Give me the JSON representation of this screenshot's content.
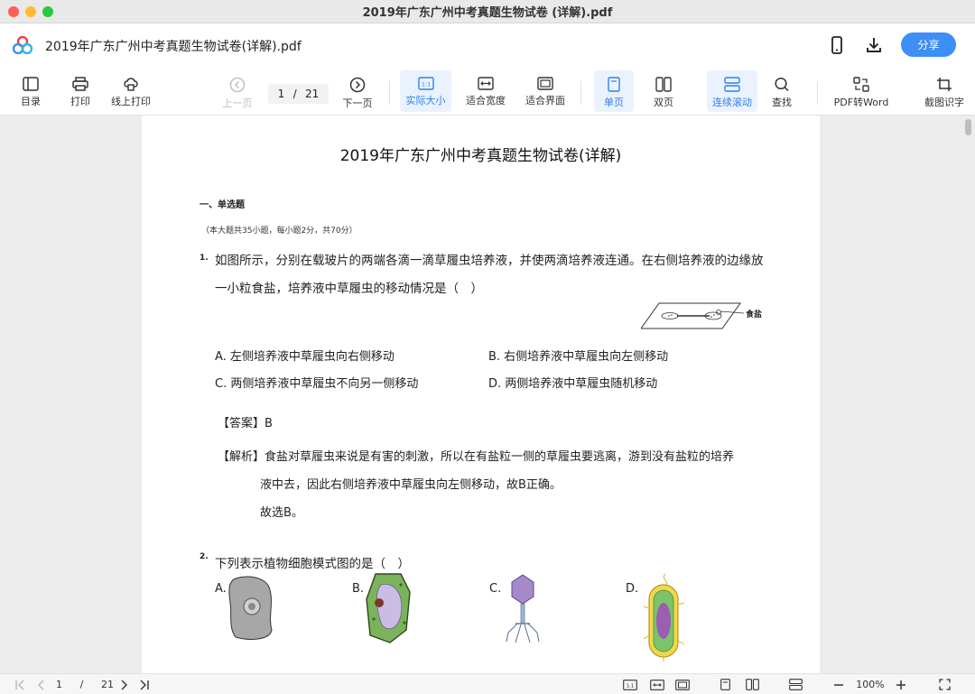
{
  "window": {
    "title": "2019年广东广州中考真题生物试卷 (详解).pdf"
  },
  "appbar": {
    "doc_name": "2019年广东广州中考真题生物试卷(详解).pdf",
    "share_label": "分享"
  },
  "toolbar": {
    "toc": "目录",
    "print": "打印",
    "online_print": "线上打印",
    "prev_page": "上一页",
    "current_page": "1",
    "page_sep": "/",
    "total_pages": "21",
    "next_page": "下一页",
    "actual_size": "实际大小",
    "fit_width": "适合宽度",
    "fit_window": "适合界面",
    "single_page": "单页",
    "double_page": "双页",
    "continuous": "连续滚动",
    "search": "查找",
    "pdf_to_word": "PDF转Word",
    "screenshot_ocr": "截图识字"
  },
  "document": {
    "title": "2019年广东广州中考真题生物试卷(详解)",
    "section": "一、单选题",
    "section_note": "（本大题共35小题，每小题2分，共70分）",
    "q1": {
      "num": "1.",
      "line1": "如图所示，分别在载玻片的两端各滴一滴草履虫培养液，并使两滴培养液连通。在右侧培养液的边缘放",
      "line2": "一小粒食盐，培养液中草履虫的移动情况是（　）",
      "figure_label": "食盐",
      "optA": "A. 左侧培养液中草履虫向右侧移动",
      "optB": "B. 右侧培养液中草履虫向左侧移动",
      "optC": "C. 两侧培养液中草履虫不向另一侧移动",
      "optD": "D. 两侧培养液中草履虫随机移动",
      "answer_tag": "【答案】",
      "answer": "B",
      "analysis_tag": "【解析】",
      "analysis1": "食盐对草履虫来说是有害的刺激，所以在有盐粒一侧的草履虫要逃离，游到没有盐粒的培养",
      "analysis2": "液中去，因此右侧培养液中草履虫向左侧移动，故B正确。",
      "analysis3": "故选B。"
    },
    "q2": {
      "num": "2.",
      "text": "下列表示植物细胞模式图的是（　）",
      "labelA": "A.",
      "labelB": "B.",
      "labelC": "C.",
      "labelD": "D."
    }
  },
  "statusbar": {
    "current_page": "1",
    "page_sep": "/",
    "total_pages": "21",
    "zoom": "100%"
  },
  "colors": {
    "accent": "#3d8ef5",
    "active_bg": "#eaf2fd"
  }
}
